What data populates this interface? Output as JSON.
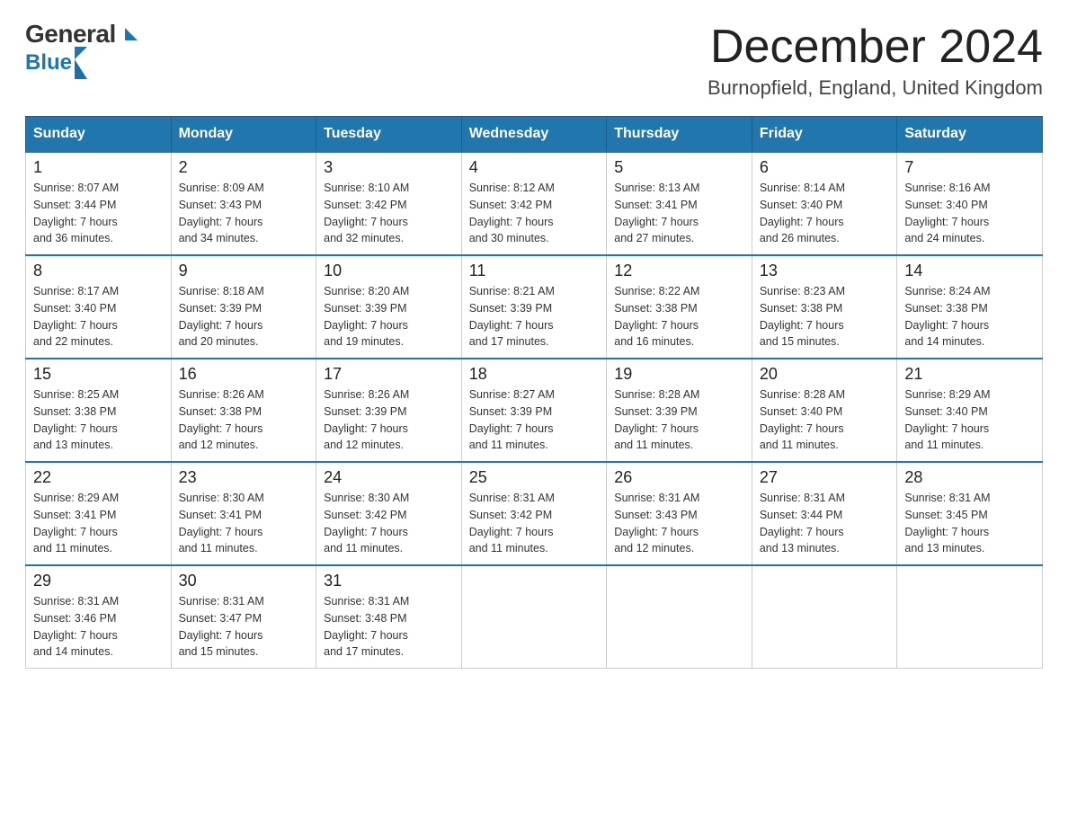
{
  "logo": {
    "general": "General",
    "blue": "Blue",
    "triangle": "▲"
  },
  "title": {
    "month_year": "December 2024",
    "location": "Burnopfield, England, United Kingdom"
  },
  "days_of_week": [
    "Sunday",
    "Monday",
    "Tuesday",
    "Wednesday",
    "Thursday",
    "Friday",
    "Saturday"
  ],
  "weeks": [
    [
      {
        "day": "1",
        "sunrise": "8:07 AM",
        "sunset": "3:44 PM",
        "daylight": "7 hours and 36 minutes."
      },
      {
        "day": "2",
        "sunrise": "8:09 AM",
        "sunset": "3:43 PM",
        "daylight": "7 hours and 34 minutes."
      },
      {
        "day": "3",
        "sunrise": "8:10 AM",
        "sunset": "3:42 PM",
        "daylight": "7 hours and 32 minutes."
      },
      {
        "day": "4",
        "sunrise": "8:12 AM",
        "sunset": "3:42 PM",
        "daylight": "7 hours and 30 minutes."
      },
      {
        "day": "5",
        "sunrise": "8:13 AM",
        "sunset": "3:41 PM",
        "daylight": "7 hours and 27 minutes."
      },
      {
        "day": "6",
        "sunrise": "8:14 AM",
        "sunset": "3:40 PM",
        "daylight": "7 hours and 26 minutes."
      },
      {
        "day": "7",
        "sunrise": "8:16 AM",
        "sunset": "3:40 PM",
        "daylight": "7 hours and 24 minutes."
      }
    ],
    [
      {
        "day": "8",
        "sunrise": "8:17 AM",
        "sunset": "3:40 PM",
        "daylight": "7 hours and 22 minutes."
      },
      {
        "day": "9",
        "sunrise": "8:18 AM",
        "sunset": "3:39 PM",
        "daylight": "7 hours and 20 minutes."
      },
      {
        "day": "10",
        "sunrise": "8:20 AM",
        "sunset": "3:39 PM",
        "daylight": "7 hours and 19 minutes."
      },
      {
        "day": "11",
        "sunrise": "8:21 AM",
        "sunset": "3:39 PM",
        "daylight": "7 hours and 17 minutes."
      },
      {
        "day": "12",
        "sunrise": "8:22 AM",
        "sunset": "3:38 PM",
        "daylight": "7 hours and 16 minutes."
      },
      {
        "day": "13",
        "sunrise": "8:23 AM",
        "sunset": "3:38 PM",
        "daylight": "7 hours and 15 minutes."
      },
      {
        "day": "14",
        "sunrise": "8:24 AM",
        "sunset": "3:38 PM",
        "daylight": "7 hours and 14 minutes."
      }
    ],
    [
      {
        "day": "15",
        "sunrise": "8:25 AM",
        "sunset": "3:38 PM",
        "daylight": "7 hours and 13 minutes."
      },
      {
        "day": "16",
        "sunrise": "8:26 AM",
        "sunset": "3:38 PM",
        "daylight": "7 hours and 12 minutes."
      },
      {
        "day": "17",
        "sunrise": "8:26 AM",
        "sunset": "3:39 PM",
        "daylight": "7 hours and 12 minutes."
      },
      {
        "day": "18",
        "sunrise": "8:27 AM",
        "sunset": "3:39 PM",
        "daylight": "7 hours and 11 minutes."
      },
      {
        "day": "19",
        "sunrise": "8:28 AM",
        "sunset": "3:39 PM",
        "daylight": "7 hours and 11 minutes."
      },
      {
        "day": "20",
        "sunrise": "8:28 AM",
        "sunset": "3:40 PM",
        "daylight": "7 hours and 11 minutes."
      },
      {
        "day": "21",
        "sunrise": "8:29 AM",
        "sunset": "3:40 PM",
        "daylight": "7 hours and 11 minutes."
      }
    ],
    [
      {
        "day": "22",
        "sunrise": "8:29 AM",
        "sunset": "3:41 PM",
        "daylight": "7 hours and 11 minutes."
      },
      {
        "day": "23",
        "sunrise": "8:30 AM",
        "sunset": "3:41 PM",
        "daylight": "7 hours and 11 minutes."
      },
      {
        "day": "24",
        "sunrise": "8:30 AM",
        "sunset": "3:42 PM",
        "daylight": "7 hours and 11 minutes."
      },
      {
        "day": "25",
        "sunrise": "8:31 AM",
        "sunset": "3:42 PM",
        "daylight": "7 hours and 11 minutes."
      },
      {
        "day": "26",
        "sunrise": "8:31 AM",
        "sunset": "3:43 PM",
        "daylight": "7 hours and 12 minutes."
      },
      {
        "day": "27",
        "sunrise": "8:31 AM",
        "sunset": "3:44 PM",
        "daylight": "7 hours and 13 minutes."
      },
      {
        "day": "28",
        "sunrise": "8:31 AM",
        "sunset": "3:45 PM",
        "daylight": "7 hours and 13 minutes."
      }
    ],
    [
      {
        "day": "29",
        "sunrise": "8:31 AM",
        "sunset": "3:46 PM",
        "daylight": "7 hours and 14 minutes."
      },
      {
        "day": "30",
        "sunrise": "8:31 AM",
        "sunset": "3:47 PM",
        "daylight": "7 hours and 15 minutes."
      },
      {
        "day": "31",
        "sunrise": "8:31 AM",
        "sunset": "3:48 PM",
        "daylight": "7 hours and 17 minutes."
      },
      null,
      null,
      null,
      null
    ]
  ],
  "labels": {
    "sunrise": "Sunrise:",
    "sunset": "Sunset:",
    "daylight": "Daylight:"
  }
}
